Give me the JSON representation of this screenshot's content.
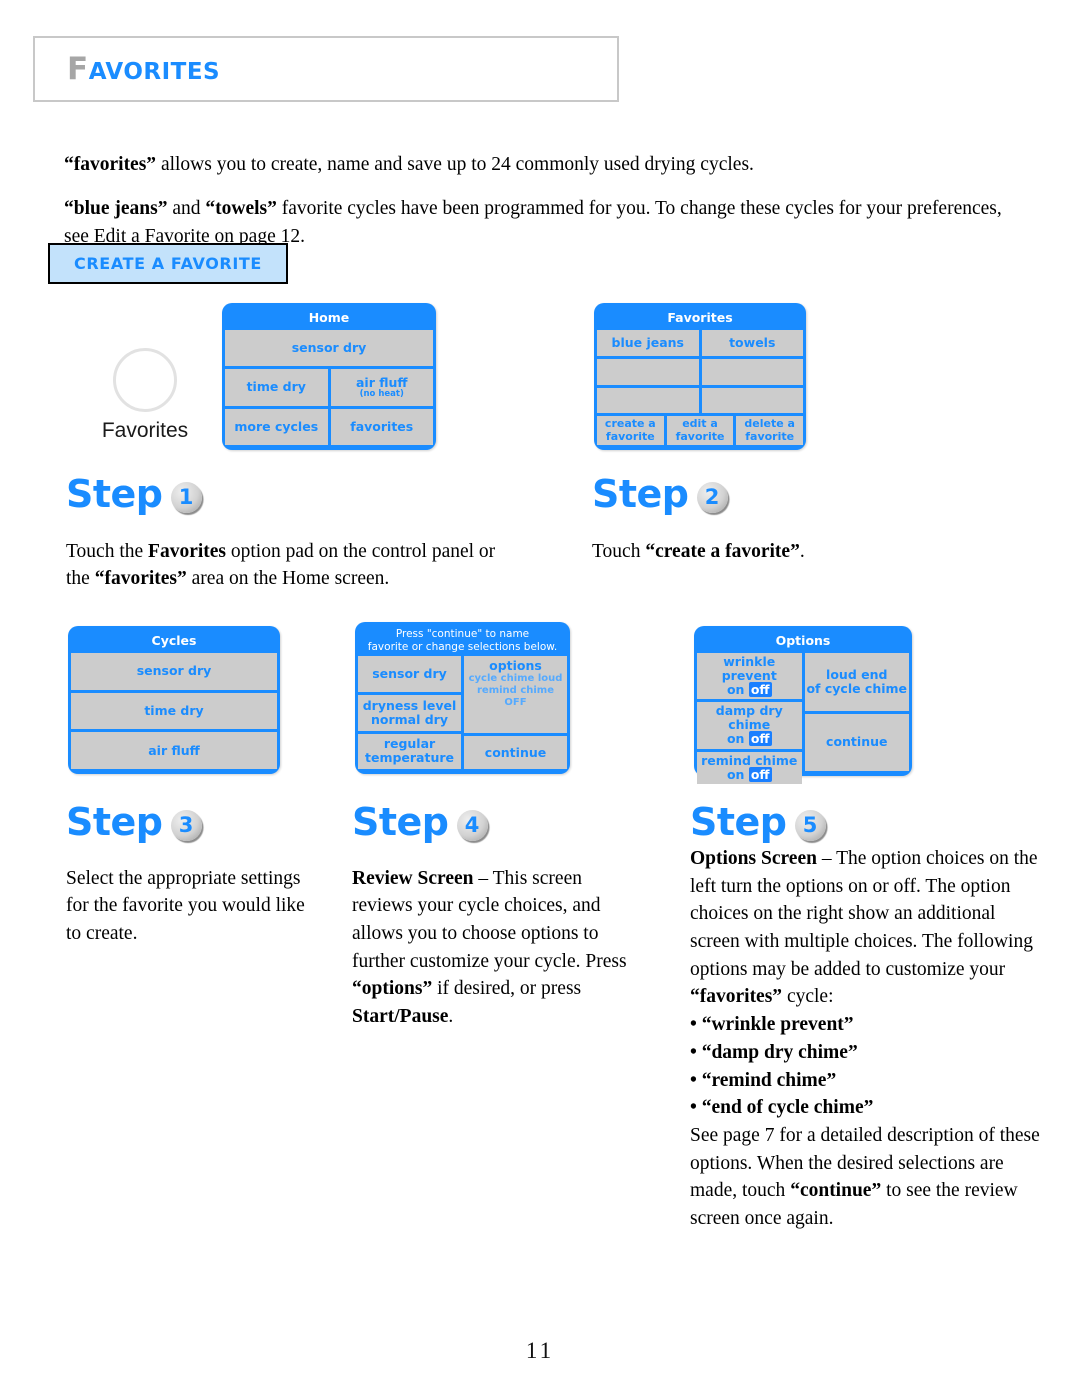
{
  "header": {
    "title_dropcap": "F",
    "title_rest": "AVORITES"
  },
  "intro": {
    "p1_bold": "“favorites”",
    "p1_rest": " allows you to create, name and save up to 24 commonly used drying cycles.",
    "p2_a": "“blue jeans”",
    "p2_b": " and ",
    "p2_c": "“towels”",
    "p2_d": " favorite cycles have been programmed for you.  To change these cycles for your preferences, see Edit a Favorite on page 12."
  },
  "section": {
    "title": "CREATE A FAVORITE"
  },
  "control_pad": {
    "label": "Favorites"
  },
  "screens": {
    "home": {
      "title": "Home",
      "cells": {
        "sensor_dry": "sensor dry",
        "time_dry": "time dry",
        "air_fluff": "air fluff",
        "air_fluff_sub": "(no heat)",
        "more_cycles": "more cycles",
        "favorites": "favorites"
      }
    },
    "favorites": {
      "title": "Favorites",
      "cells": {
        "blue_jeans": "blue jeans",
        "towels": "towels",
        "create_a": "create a",
        "create_b": "favorite",
        "edit_a": "edit a",
        "edit_b": "favorite",
        "delete_a": "delete a",
        "delete_b": "favorite"
      }
    },
    "cycles": {
      "title": "Cycles",
      "cells": {
        "sensor_dry": "sensor dry",
        "time_dry": "time dry",
        "air_fluff": "air fluff"
      }
    },
    "review": {
      "title_line1": "Press \"continue\" to name",
      "title_line2": "favorite or change selections below.",
      "cells": {
        "sensor_dry": "sensor dry",
        "dryness_level": "dryness level",
        "dryness_value": "normal dry",
        "regular": "regular",
        "temperature": "temperature",
        "options": "options",
        "options_line1": "cycle chime loud",
        "options_line2": "remind chime OFF",
        "continue": "continue"
      }
    },
    "options": {
      "title": "Options",
      "cells": {
        "wrinkle_prevent": "wrinkle prevent",
        "wrinkle_on": "on",
        "wrinkle_off": "off",
        "damp_dry_chime": "damp dry chime",
        "damp_on": "on",
        "damp_off": "off",
        "remind_chime": "remind chime",
        "remind_on": "on",
        "remind_off": "off",
        "loud_end_line1": "loud end",
        "loud_end_line2": "of cycle chime",
        "continue": "continue"
      }
    }
  },
  "steps": {
    "word": "Step",
    "s1": {
      "number": "1",
      "body_a": "Touch the ",
      "body_b": "Favorites",
      "body_c": " option pad on the control panel or the ",
      "body_d": "“favorites”",
      "body_e": " area on the Home screen."
    },
    "s2": {
      "number": "2",
      "body_a": "Touch ",
      "body_b": "“create a favorite”",
      "body_c": "."
    },
    "s3": {
      "number": "3",
      "body": "Select the appropriate settings for the favorite you would like to create."
    },
    "s4": {
      "number": "4",
      "body_a": "Review Screen",
      "body_b": " – This screen reviews your cycle choices, and allows you to choose options to further customize your cycle.  Press ",
      "body_c": "“options”",
      "body_d": " if desired, or press ",
      "body_e": "Start/Pause",
      "body_f": "."
    },
    "s5": {
      "number": "5",
      "body_a": "Options Screen",
      "body_b": " – The option choices on the left turn the options on or off. The option choices on the right show an additional screen with multiple choices. The following options may be added to customize your ",
      "body_c": "“favorites”",
      "body_d": " cycle:",
      "bullets": [
        "“wrinkle prevent”",
        "“damp dry chime”",
        "“remind chime”",
        "“end of cycle chime”"
      ],
      "body_e": "See page 7 for a detailed description of these options. When the desired selections are made, touch ",
      "body_f": "“continue”",
      "body_g": " to see the review screen once again."
    }
  },
  "footer": {
    "page_number": "11"
  },
  "colors": {
    "accent_blue": "#1a8cff",
    "screen_cell_gray": "#cccccc",
    "section_box_bg": "#c3e2fb",
    "dropcap_gray": "#a6a6a6"
  }
}
